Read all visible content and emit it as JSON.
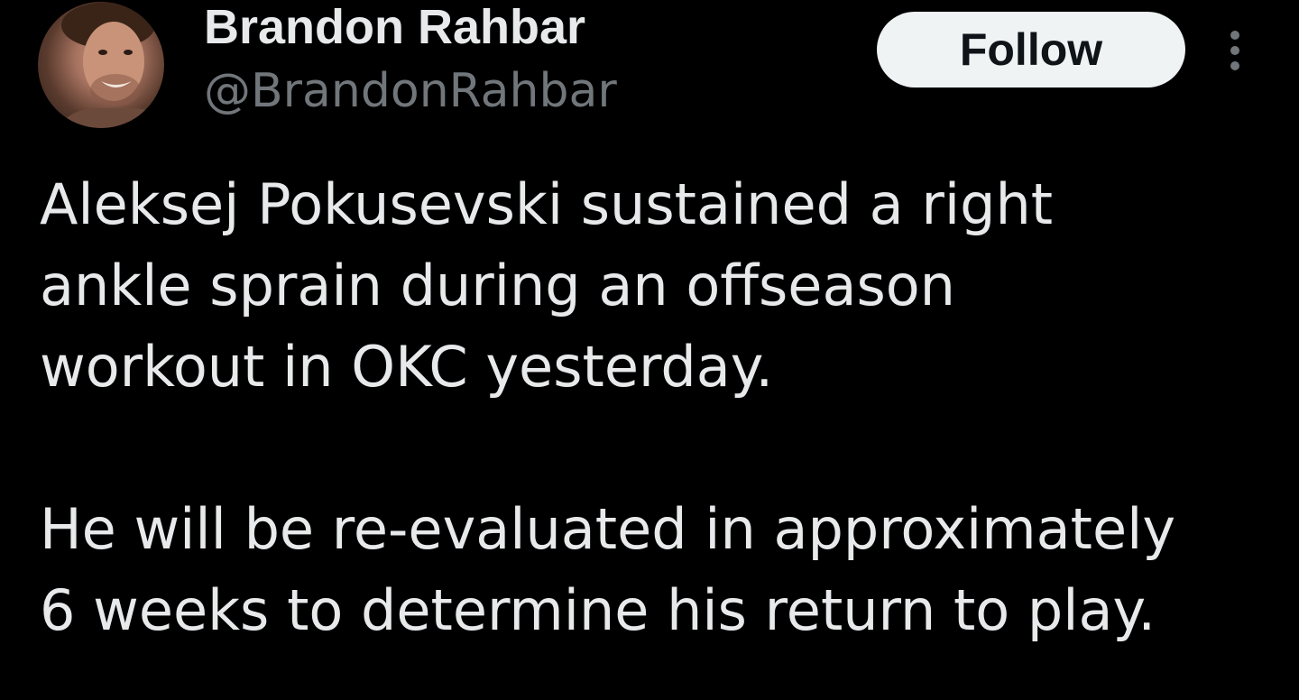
{
  "author": {
    "display_name": "Brandon Rahbar",
    "handle": "@BrandonRahbar"
  },
  "actions": {
    "follow_label": "Follow",
    "more_icon": "more-vertical-icon"
  },
  "tweet": {
    "paragraphs": [
      "Aleksej Pokusevski sustained a right\nankle sprain during an offseason\nworkout in OKC yesterday.",
      "He will be re-evaluated in approximately\n6 weeks to determine his return to play."
    ]
  },
  "colors": {
    "background": "#000000",
    "primary_text": "#e7e9ea",
    "secondary_text": "#71767b",
    "button_background": "#eff3f4",
    "button_text": "#0f1419"
  }
}
